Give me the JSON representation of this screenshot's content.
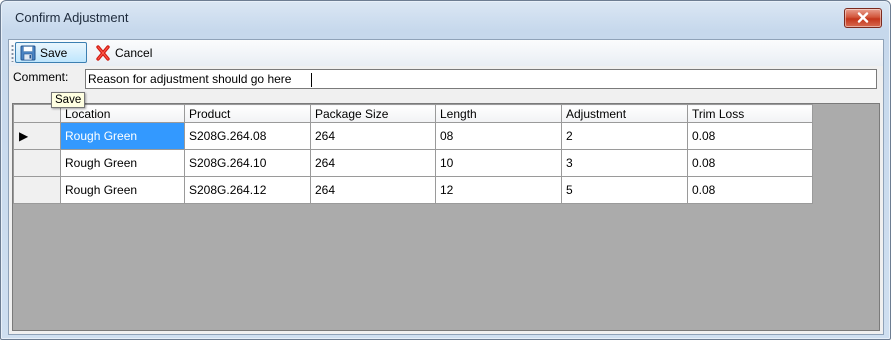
{
  "window": {
    "title": "Confirm Adjustment"
  },
  "toolbar": {
    "save_label": "Save",
    "cancel_label": "Cancel",
    "save_icon": "floppy-disk-icon",
    "cancel_icon": "red-x-icon"
  },
  "tooltip": {
    "text": "Save"
  },
  "comment": {
    "label": "Comment:",
    "value": "Reason for adjustment should go here"
  },
  "grid": {
    "columns": [
      "Location",
      "Product",
      "Package Size",
      "Length",
      "Adjustment",
      "Trim Loss"
    ],
    "rows": [
      [
        "Rough Green",
        "S208G.264.08",
        "264",
        "08",
        "2",
        "0.08"
      ],
      [
        "Rough Green",
        "S208G.264.10",
        "264",
        "10",
        "3",
        "0.08"
      ],
      [
        "Rough Green",
        "S208G.264.12",
        "264",
        "12",
        "5",
        "0.08"
      ]
    ],
    "current_row_indicator": "▶",
    "selection_color": "#3399ff",
    "background_color": "#ababab"
  }
}
